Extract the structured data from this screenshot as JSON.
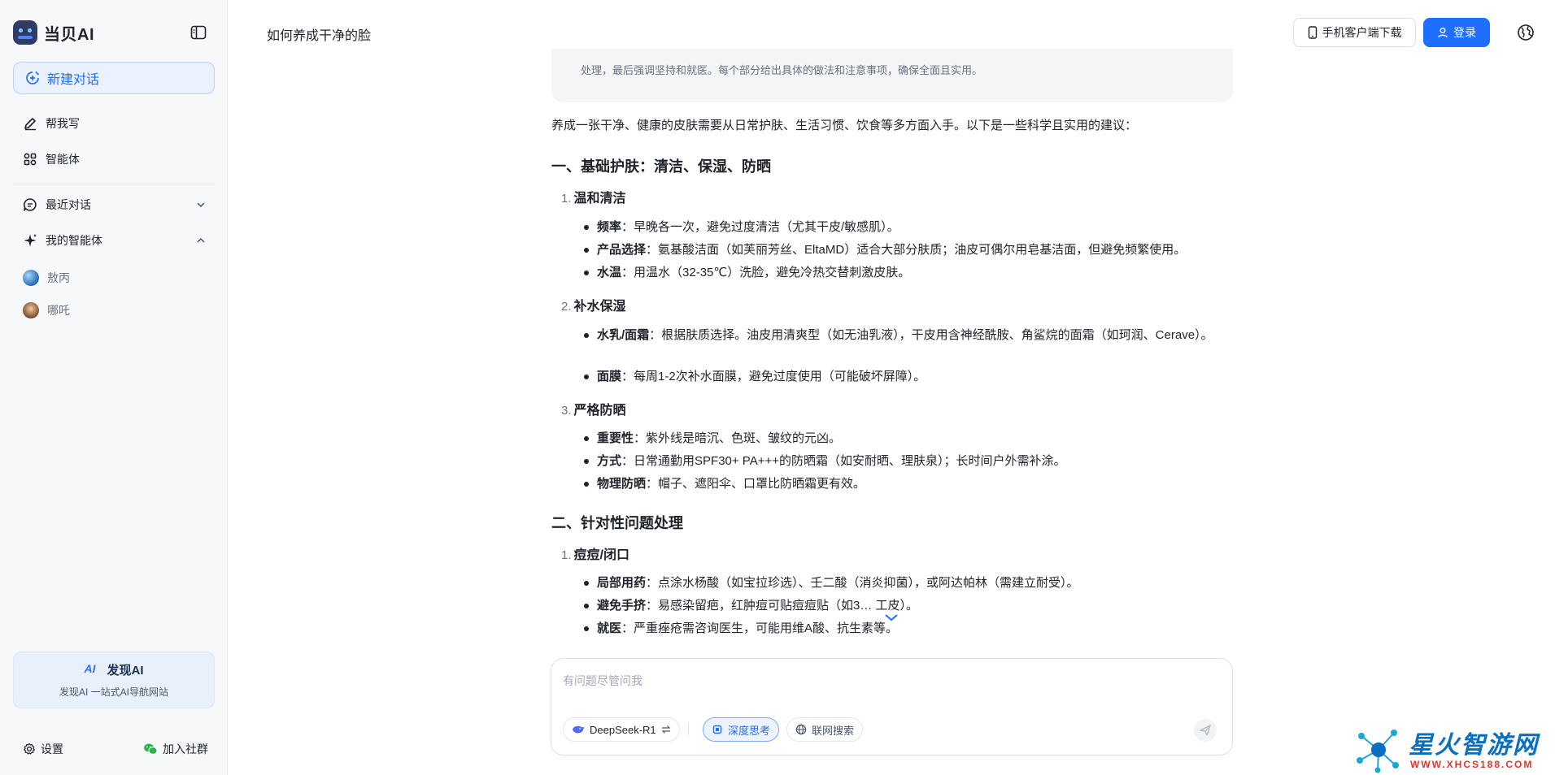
{
  "app": {
    "brand_name": "当贝AI"
  },
  "sidebar": {
    "new_chat_label": "新建对话",
    "nav": [
      {
        "label": "帮我写",
        "icon": "pen-icon"
      },
      {
        "label": "智能体",
        "icon": "grid-icon"
      },
      {
        "label": "最近对话",
        "icon": "chat-icon"
      },
      {
        "label": "我的智能体",
        "icon": "sparkle-icon"
      }
    ],
    "agents": [
      {
        "label": "敖丙",
        "icon": "avatar"
      },
      {
        "label": "哪吒",
        "icon": "avatar"
      }
    ],
    "promo": {
      "title": "发现AI",
      "subtitle": "发现AI 一站式AI导航网站"
    },
    "settings_label": "设置",
    "join_group_label": "加入社群"
  },
  "header": {
    "title": "如何养成干净的脸",
    "download_label": "手机客户端下载",
    "login_label": "登录"
  },
  "content": {
    "thinking_text": "处理，最后强调坚持和就医。每个部分给出具体的做法和注意事项，确保全面且实用。",
    "intro": "养成一张干净、健康的皮肤需要从日常护肤、生活习惯、饮食等多方面入手。以下是一些科学且实用的建议：",
    "section1": {
      "title": "一、基础护肤：清洁、保湿、防晒",
      "sub1": {
        "num": "1.",
        "title": "温和清洁",
        "b1_key": "频率",
        "b1_text": "：早晚各一次，避免过度清洁（尤其干皮/敏感肌）。",
        "b2_key": "产品选择",
        "b2_text": "：氨基酸洁面（如芙丽芳丝、EltaMD）适合大部分肤质；油皮可偶尔用皂基洁面，但避免频繁使用。",
        "b3_key": "水温",
        "b3_text": "：用温水（32-35℃）洗脸，避免冷热交替刺激皮肤。"
      },
      "sub2": {
        "num": "2.",
        "title": "补水保湿",
        "b1_key": "水乳/面霜",
        "b1_text": "：根据肤质选择。油皮用清爽型（如无油乳液），干皮用含神经酰胺、角鲨烷的面霜（如珂润、Cerave）。",
        "b2_key": "面膜",
        "b2_text": "：每周1-2次补水面膜，避免过度使用（可能破坏屏障）。"
      },
      "sub3": {
        "num": "3.",
        "title": "严格防晒",
        "b1_key": "重要性",
        "b1_text": "：紫外线是暗沉、色斑、皱纹的元凶。",
        "b2_key": "方式",
        "b2_text": "：日常通勤用SPF30+ PA+++的防晒霜（如安耐晒、理肤泉）；长时间户外需补涂。",
        "b3_key": "物理防晒",
        "b3_text": "：帽子、遮阳伞、口罩比防晒霜更有效。"
      }
    },
    "section2": {
      "title": "二、针对性问题处理",
      "sub1": {
        "num": "1.",
        "title": "痘痘/闭口",
        "b1_key": "局部用药",
        "b1_text": "：点涂水杨酸（如宝拉珍选）、壬二酸（消炎抑菌），或阿达帕林（需建立耐受）。",
        "b2_key": "避免手挤",
        "b2_text": "：易感染留疤，红肿痘可贴痘痘贴（如3… 工皮）。",
        "b3_key": "就医",
        "b3_text": "：严重痤疮需咨询医生，可能用维A酸、抗生素等。"
      }
    }
  },
  "composer": {
    "placeholder": "有问题尽管问我",
    "model_label": "DeepSeek-R1",
    "deep_think_label": "深度思考",
    "web_search_label": "联网搜索"
  },
  "watermark": {
    "title": "星火智游网",
    "url": "WWW.XHCS188.COM"
  },
  "colors": {
    "accent": "#1e6fff",
    "sidebar_bg": "#f7f8fa",
    "thinking_bg": "#f4f5f7",
    "watermark_blue": "#0b6fbf",
    "watermark_red": "#e0352b"
  }
}
